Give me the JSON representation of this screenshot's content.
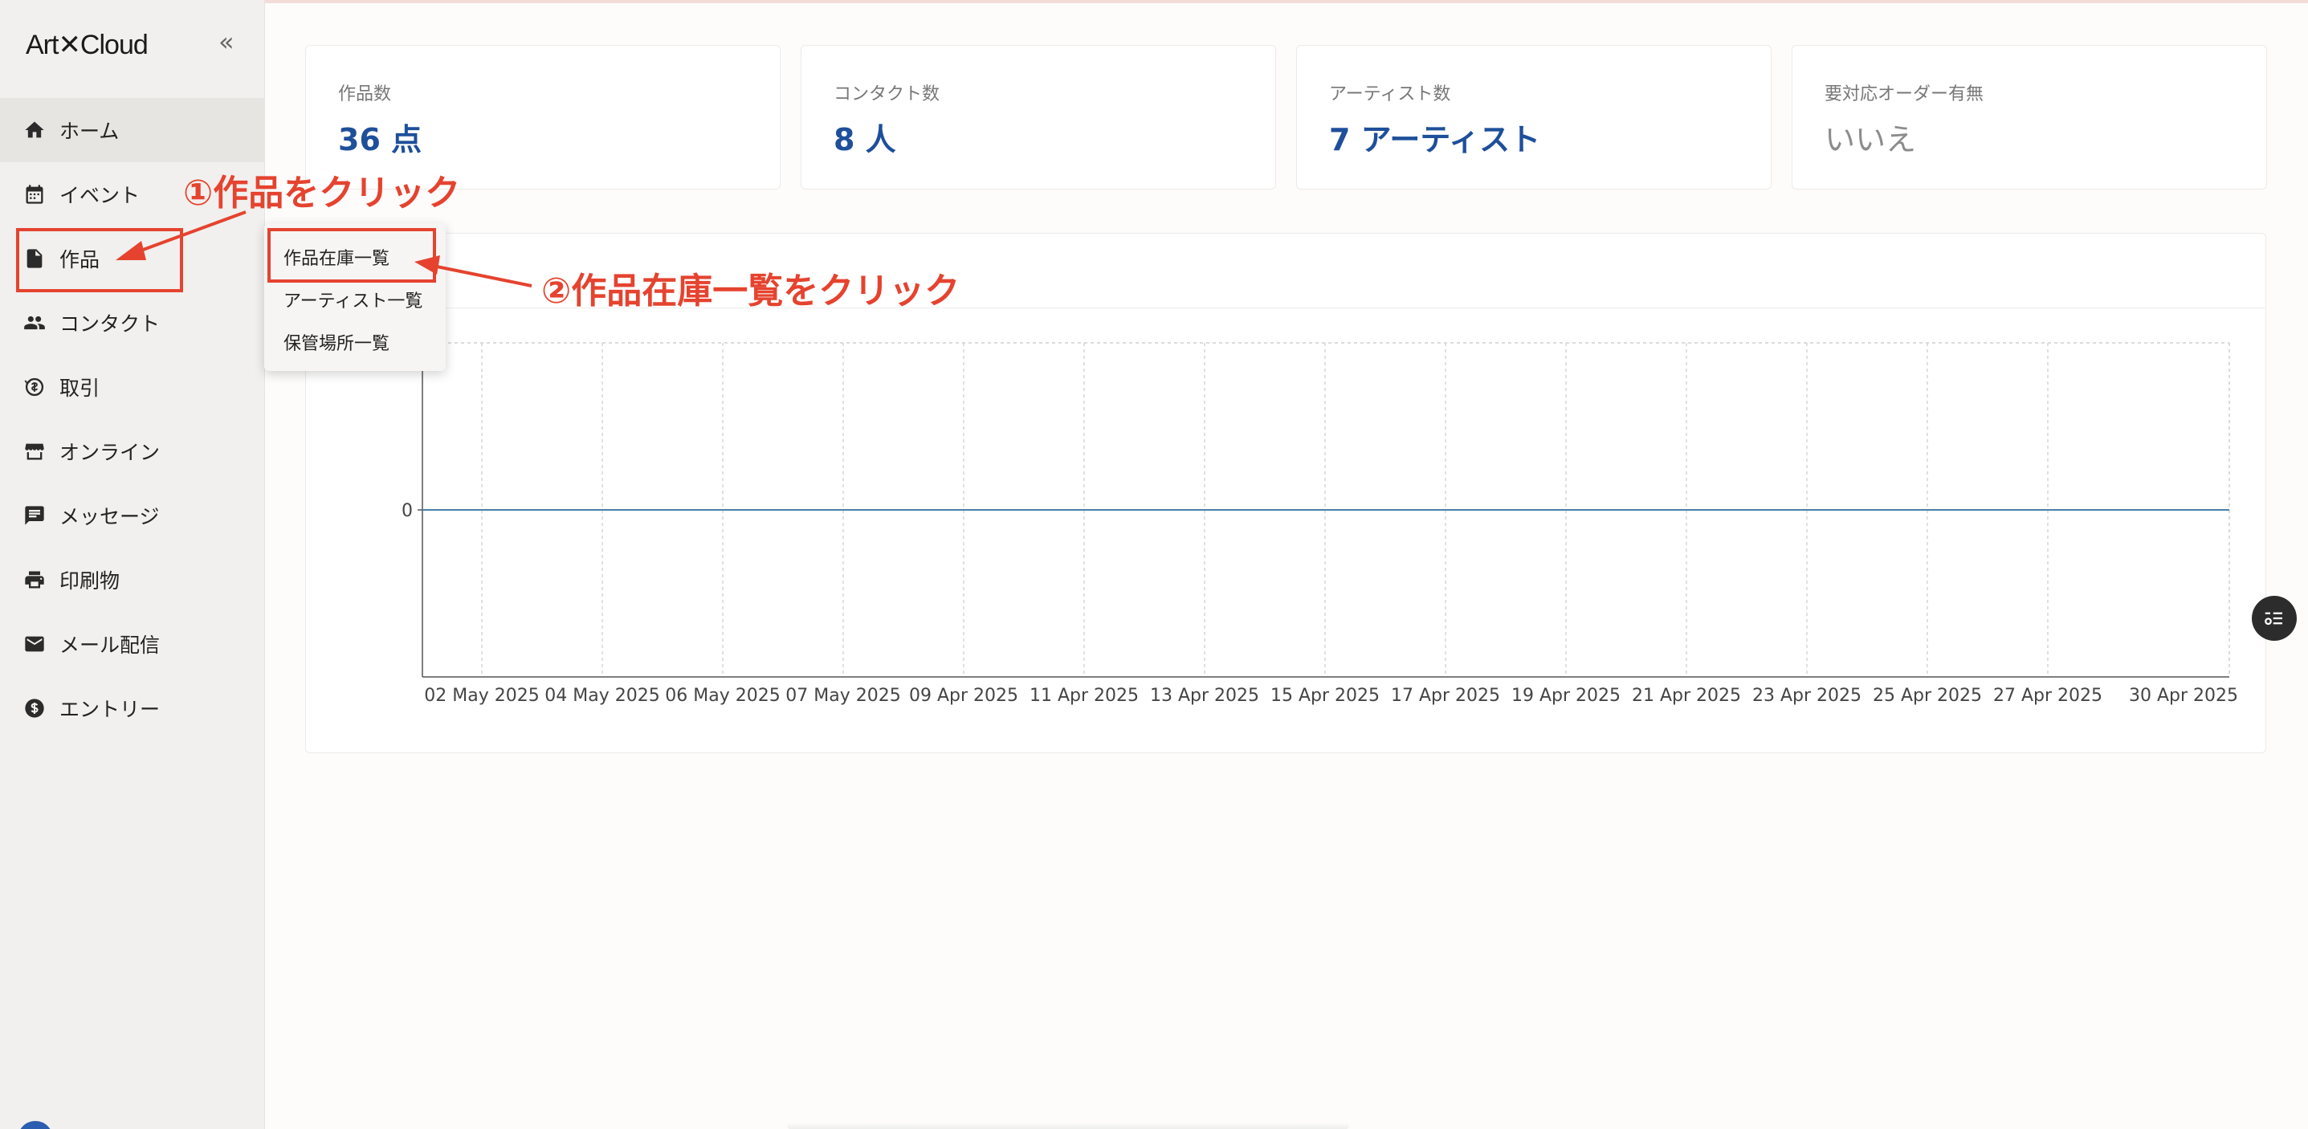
{
  "app": {
    "logo": "Art✕Cloud",
    "collapse_glyph": "«"
  },
  "sidebar": {
    "items": [
      {
        "label": "ホーム",
        "icon": "home-icon"
      },
      {
        "label": "イベント",
        "icon": "calendar-icon"
      },
      {
        "label": "作品",
        "icon": "document-icon"
      },
      {
        "label": "コンタクト",
        "icon": "people-icon"
      },
      {
        "label": "取引",
        "icon": "exchange-icon"
      },
      {
        "label": "オンライン",
        "icon": "storefront-icon"
      },
      {
        "label": "メッセージ",
        "icon": "message-icon"
      },
      {
        "label": "印刷物",
        "icon": "printer-icon"
      },
      {
        "label": "メール配信",
        "icon": "mail-icon"
      },
      {
        "label": "エントリー",
        "icon": "dollar-icon"
      }
    ]
  },
  "stats": [
    {
      "label": "作品数",
      "value": "36 点"
    },
    {
      "label": "コンタクト数",
      "value": "8 人"
    },
    {
      "label": "アーティスト数",
      "value": "7 アーティスト"
    },
    {
      "label": "要対応オーダー有無",
      "value": "いいえ"
    }
  ],
  "dropdown": {
    "items": [
      "作品在庫一覧",
      "アーティスト一覧",
      "保管場所一覧"
    ]
  },
  "annotations": {
    "step1": "①作品をクリック",
    "step2": "②作品在庫一覧をクリック",
    "color": "#e5432f"
  },
  "chart_data": {
    "type": "line",
    "categories": [
      "02 May 2025",
      "04 May 2025",
      "06 May 2025",
      "07 May 2025",
      "09 Apr 2025",
      "11 Apr 2025",
      "13 Apr 2025",
      "15 Apr 2025",
      "17 Apr 2025",
      "19 Apr 2025",
      "21 Apr 2025",
      "23 Apr 2025",
      "25 Apr 2025",
      "27 Apr 2025",
      "30 Apr 2025"
    ],
    "values": [
      0,
      0,
      0,
      0,
      0,
      0,
      0,
      0,
      0,
      0,
      0,
      0,
      0,
      0,
      0
    ],
    "y_ticks": [
      "0"
    ],
    "grid": true,
    "line_color": "#4a7fa8"
  },
  "colors": {
    "accent_blue": "#1e4f9a",
    "sidebar_bg": "#f1f0ee"
  }
}
